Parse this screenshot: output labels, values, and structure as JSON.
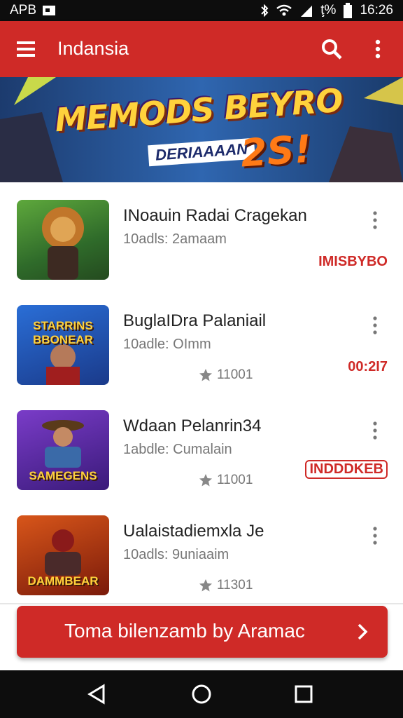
{
  "status_bar": {
    "carrier": "APB",
    "time": "16:26",
    "battery_text": "ţ%"
  },
  "app_bar": {
    "title": "Indansia"
  },
  "banner": {
    "headline": "MEMODS BEYRO",
    "subline": "DERIAAAAN",
    "badge": "2S!"
  },
  "games": [
    {
      "name": "INoauin Radai Cragekan",
      "meta": "10adls: 2amaam",
      "rating": "",
      "tag": "IMISBYBO",
      "thumb_title": ""
    },
    {
      "name": "BuglaIDra Palaniail",
      "meta": "10adle: OImm",
      "rating": "11001",
      "tag": "00:2I7",
      "thumb_title": "STARRINS BBONEAR"
    },
    {
      "name": "Wdaan Pelanrin34",
      "meta": "1abdle: Cumalain",
      "rating": "11001",
      "tag": "INDDDKEB",
      "thumb_title": "SAMEGENS"
    },
    {
      "name": "Ualaistadiemxla Je",
      "meta": "10adls: 9uniaaim",
      "rating": "11301",
      "tag": "",
      "thumb_title": "DAMMBEAR"
    }
  ],
  "cta": {
    "label": "Toma bilenzamb by Aramac"
  },
  "icons": {
    "menu": "menu-icon",
    "search": "search-icon",
    "more": "more-vert-icon",
    "star": "star-icon",
    "chevron": "chevron-right-icon",
    "back": "back-icon",
    "home": "home-icon",
    "recents": "recents-icon"
  },
  "colors": {
    "primary": "#cf2a27",
    "status_bar": "#0d0d0d",
    "text": "#222222",
    "secondary_text": "#777777"
  }
}
